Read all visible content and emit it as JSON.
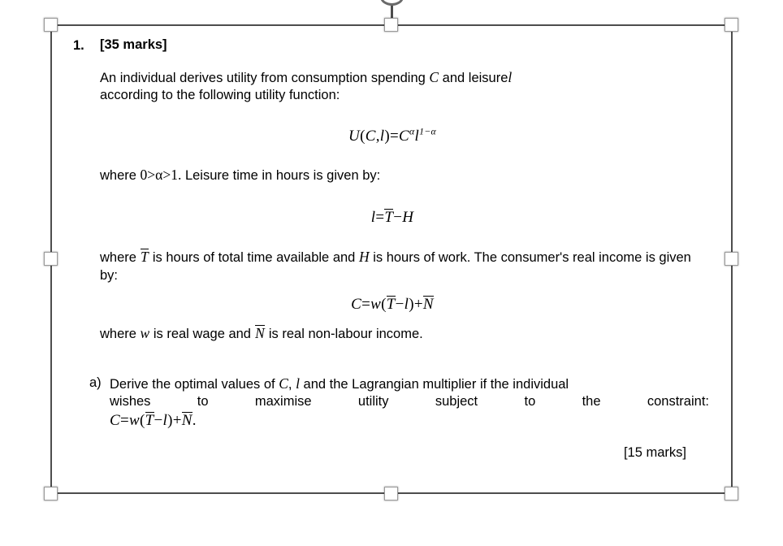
{
  "document": {
    "question": {
      "number": "1.",
      "marks_title": "[35 marks]"
    },
    "paragraphs": {
      "intro_line1": "An individual derives utility from consumption spending",
      "intro_var_c": "C",
      "intro_and": "and",
      "intro_leisure_word": "leisure",
      "intro_var_l": "l",
      "intro_line2": "according to the following utility function:",
      "where_alpha_prefix": "where",
      "where_alpha_range": "0>α>1.",
      "where_alpha_rest": "Leisure time in hours is given by:",
      "where_T_prefix": "where",
      "where_T_var": "T",
      "where_T_mid": "is hours of total time available and",
      "where_H_var": "H",
      "where_T_rest": "is hours of work. The consumer's real income is given by:",
      "where_w_prefix": "where",
      "where_w_var": "w",
      "where_w_mid": "is real wage and",
      "where_N_var": "N",
      "where_w_rest": "is real non-labour income."
    },
    "equations": {
      "utility": {
        "lhs_fn": "U",
        "lhs_open": "(",
        "lhs_c": "C",
        "lhs_comma": ",",
        "lhs_l": "l",
        "lhs_close": ")",
        "equals": "=",
        "rhs_c": "C",
        "rhs_c_exp": "α",
        "rhs_l": "l",
        "rhs_l_exp": "1−α",
        "plain": "U(C,l)=C^α l^(1−α)"
      },
      "leisure": {
        "lhs": "l",
        "equals": "=",
        "t_bar": "T",
        "minus": "−",
        "h": "H",
        "plain": "l=T̄−H"
      },
      "income": {
        "lhs": "C",
        "equals": "=",
        "w": "w",
        "open": "(",
        "t_bar": "T",
        "minus": "−",
        "l": "l",
        "close": ")",
        "plus": "+",
        "n_bar": "N",
        "plain": "C=w(T̄−l)+N̄"
      },
      "constraint_a": {
        "lhs": "C",
        "equals": "=",
        "w": "w",
        "open": "(",
        "t_bar": "T",
        "minus": "−",
        "l": "l",
        "close": ")",
        "plus": "+",
        "n_bar": "N",
        "period": ".",
        "plain": "C=w(T̄−l)+N̄."
      }
    },
    "part_a": {
      "label": "a)",
      "line1_pre": "Derive the optimal values of",
      "line1_var_c": "C",
      "line1_comma": ",",
      "line1_var_l": "l",
      "line1_post": "and the Lagrangian multiplier if the individual",
      "line2": "wishes to maximise utility subject to the constraint:",
      "marks": "[15 marks]"
    }
  },
  "selection": {
    "handle_count": 8,
    "handle_fill": "#ffffff",
    "handle_border": "#9a9a9a",
    "frame_color": "#4d4d4d",
    "rotation_handle": "rotate-handle"
  }
}
